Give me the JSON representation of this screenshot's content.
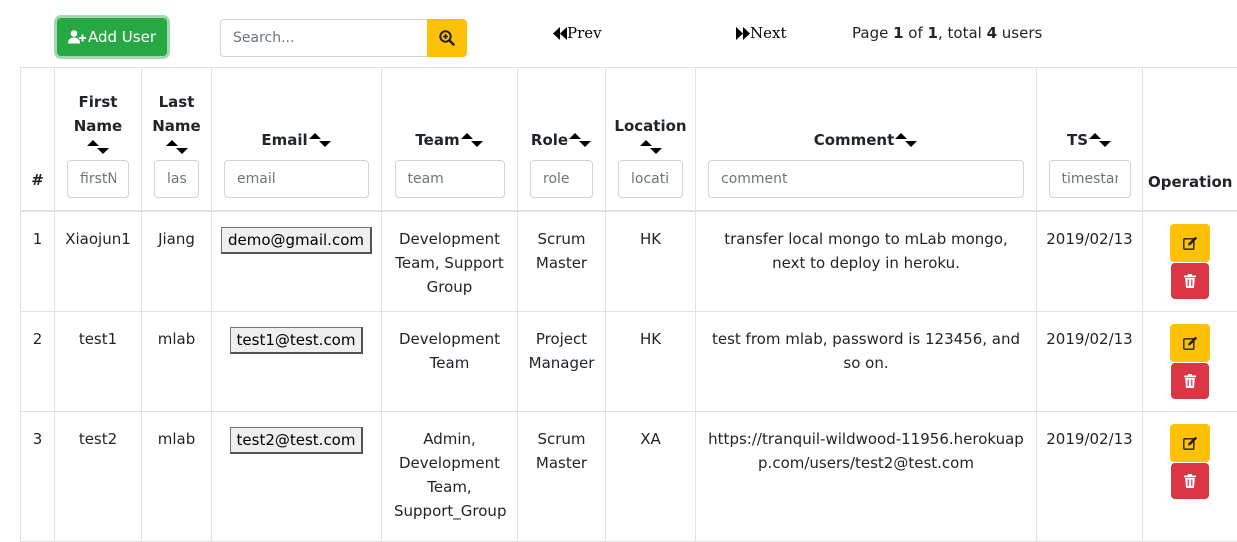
{
  "toolbar": {
    "add_user_label": "Add User",
    "search_placeholder": "Search...",
    "prev_label": "Prev",
    "next_label": "Next",
    "page_prefix": "Page ",
    "page_current": "1",
    "page_of": " of ",
    "page_total": "1",
    "page_total_prefix": ", total ",
    "users_total": "4",
    "users_suffix": " users"
  },
  "table": {
    "headers": {
      "index": "#",
      "first_name": "First Name",
      "last_name": "Last Name",
      "email": "Email",
      "team": "Team",
      "role": "Role",
      "location": "Location",
      "comment": "Comment",
      "ts": "TS",
      "operation": "Operation"
    },
    "filters": {
      "first_name": "firstName",
      "last_name": "lastName",
      "email": "email",
      "team": "team",
      "role": "role",
      "location": "location",
      "comment": "comment",
      "ts": "timestamp"
    },
    "rows": [
      {
        "index": "1",
        "first_name": "Xiaojun1",
        "last_name": "Jiang",
        "email": "demo@gmail.com",
        "team": "Development Team, Support Group",
        "role": "Scrum Master",
        "location": "HK",
        "comment": "transfer local mongo to mLab mongo, next to deploy in heroku.",
        "ts": "2019/02/13"
      },
      {
        "index": "2",
        "first_name": "test1",
        "last_name": "mlab",
        "email": "test1@test.com",
        "team": "Development Team",
        "role": "Project Manager",
        "location": "HK",
        "comment": "test from mlab, password is 123456, and so on.",
        "ts": "2019/02/13"
      },
      {
        "index": "3",
        "first_name": "test2",
        "last_name": "mlab",
        "email": "test2@test.com",
        "team": "Admin, Development Team, Support_Group",
        "role": "Scrum Master",
        "location": "XA",
        "comment": "https://tranquil-wildwood-11956.herokuapp.com/users/test2@test.com",
        "ts": "2019/02/13"
      }
    ]
  },
  "colors": {
    "add_button": "#28a745",
    "search_button": "#ffc107",
    "edit_button": "#ffc107",
    "delete_button": "#dc3545"
  },
  "icons": {
    "add_user": "user-plus-icon",
    "search": "zoom-in-icon",
    "prev": "backward-icon",
    "next": "forward-icon",
    "edit": "edit-icon",
    "delete": "trash-icon",
    "sort": "sort-icon"
  }
}
